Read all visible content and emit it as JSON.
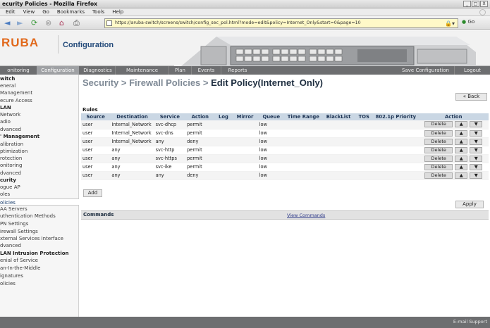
{
  "window": {
    "title": "ecurity Policies - Mozilla Firefox",
    "controls": [
      "_",
      "□",
      "X"
    ]
  },
  "menu": [
    "Edit",
    "View",
    "Go",
    "Bookmarks",
    "Tools",
    "Help"
  ],
  "toolbar": {
    "back_icon": "back-arrow-icon",
    "forward_icon": "forward-arrow-icon",
    "url": "https://aruba-switch/screens/switch/config_sec_pol.html?mode=edit&policy=Internet_Only&start=0&page=10",
    "go_label": "Go"
  },
  "header": {
    "logo": "RUBA",
    "title": "Configuration"
  },
  "tabs": [
    {
      "label": "onitoring"
    },
    {
      "label": "Configuration"
    },
    {
      "label": "Diagnostics"
    },
    {
      "label": "Maintenance"
    },
    {
      "label": "Plan"
    },
    {
      "label": "Events"
    },
    {
      "label": "Reports"
    },
    {
      "label": "Save Configuration"
    },
    {
      "label": "Logout"
    }
  ],
  "sidebar": [
    {
      "label": "witch",
      "type": "head"
    },
    {
      "label": "eneral"
    },
    {
      "label": "Management"
    },
    {
      "label": "ecure Access"
    },
    {
      "label": "LAN",
      "type": "head"
    },
    {
      "label": "Network"
    },
    {
      "label": "adio"
    },
    {
      "label": "dvanced"
    },
    {
      "label": "' Management",
      "type": "head"
    },
    {
      "label": "alibration"
    },
    {
      "label": "ptimization"
    },
    {
      "label": "rotection"
    },
    {
      "label": "onitoring"
    },
    {
      "label": "dvanced"
    },
    {
      "label": "curity",
      "type": "head"
    },
    {
      "label": "ogue AP"
    },
    {
      "label": "oles"
    },
    {
      "label": "olicies",
      "active": true
    },
    {
      "label": "AA Servers"
    },
    {
      "label": "uthentication Methods"
    },
    {
      "label": "PN Settings"
    },
    {
      "label": "irewall Settings"
    },
    {
      "label": "xternal Services Interface"
    },
    {
      "label": "dvanced"
    },
    {
      "label": "LAN Intrusion Protection",
      "type": "head"
    },
    {
      "label": "enial of Service"
    },
    {
      "label": "an-In-the-Middle"
    },
    {
      "label": "ignatures"
    },
    {
      "label": "olicies"
    }
  ],
  "page": {
    "breadcrumb": "Security > Firewall Policies > ",
    "title": "Edit Policy(Internet_Only)",
    "back_label": "« Back",
    "rules_label": "Rules",
    "columns": [
      "Source",
      "Destination",
      "Service",
      "Action",
      "Log",
      "Mirror",
      "Queue",
      "Time Range",
      "BlackList",
      "TOS",
      "802.1p Priority",
      "Action"
    ],
    "rows": [
      [
        "user",
        "Internal_Network",
        "svc-dhcp",
        "permit",
        "",
        "",
        "low",
        "",
        "",
        "",
        ""
      ],
      [
        "user",
        "Internal_Network",
        "svc-dns",
        "permit",
        "",
        "",
        "low",
        "",
        "",
        "",
        ""
      ],
      [
        "user",
        "Internal_Network",
        "any",
        "deny",
        "",
        "",
        "low",
        "",
        "",
        "",
        ""
      ],
      [
        "user",
        "any",
        "svc-http",
        "permit",
        "",
        "",
        "low",
        "",
        "",
        "",
        ""
      ],
      [
        "user",
        "any",
        "svc-https",
        "permit",
        "",
        "",
        "low",
        "",
        "",
        "",
        ""
      ],
      [
        "user",
        "any",
        "svc-ike",
        "permit",
        "",
        "",
        "low",
        "",
        "",
        "",
        ""
      ],
      [
        "user",
        "any",
        "any",
        "deny",
        "",
        "",
        "low",
        "",
        "",
        "",
        ""
      ]
    ],
    "delete_label": "Delete",
    "up_label": "▲",
    "down_label": "▼",
    "add_label": "Add",
    "apply_label": "Apply",
    "commands_label": "Commands",
    "view_commands_label": "View Commands"
  },
  "footer": {
    "email_support": "E-mail Support"
  },
  "colors": {
    "accent": "#e1681b",
    "tab_bg": "#6d6e70",
    "table_header": "#cad7e4"
  }
}
